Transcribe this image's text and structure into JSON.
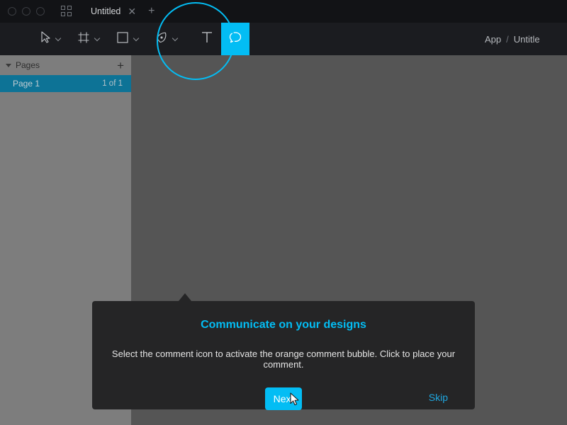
{
  "titlebar": {
    "window_controls_icon": "window-dots",
    "apps_grid_icon": "grid-icon",
    "tab": {
      "label": "Untitled",
      "close_icon": "close-icon"
    },
    "new_tab_icon": "plus-icon"
  },
  "toolbar": {
    "menu_icon": "hamburger-icon",
    "tools": [
      {
        "icon": "cursor-select-icon",
        "dropdown_icon": "chevron-down-icon"
      },
      {
        "icon": "frame-icon",
        "dropdown_icon": "chevron-down-icon"
      },
      {
        "icon": "rectangle-icon",
        "dropdown_icon": "chevron-down-icon"
      },
      {
        "icon": "pen-icon",
        "dropdown_icon": "chevron-down-icon"
      }
    ],
    "text_tool": {
      "icon": "text-tool-icon",
      "label": "T"
    },
    "comment_tool": {
      "icon": "comment-bubble-icon",
      "active": true,
      "accent": "#03bdf4"
    },
    "breadcrumb": {
      "root": "App",
      "separator": "/",
      "current": "Untitle"
    }
  },
  "left_panel": {
    "section_title": "Pages",
    "collapse_icon": "triangle-down-icon",
    "add_icon": "plus-icon",
    "pages": [
      {
        "name": "Page 1",
        "count": "1 of 1",
        "selected": true
      }
    ]
  },
  "coachmark": {
    "title": "Communicate on your designs",
    "body": "Select the comment icon to activate the orange comment bubble. Click to place your comment.",
    "next_label": "Next",
    "skip_label": "Skip",
    "accent": "#03bdf4"
  },
  "colors": {
    "titlebar_bg": "#121316",
    "toolbar_bg": "#1b1c20",
    "left_panel_bg": "#7d7d7d",
    "canvas_bg": "#555555",
    "page_selected_bg": "#0d7396",
    "dialog_bg": "#252526",
    "accent_cyan": "#03bdf4"
  },
  "cursor": {
    "icon": "mouse-pointer-icon"
  }
}
